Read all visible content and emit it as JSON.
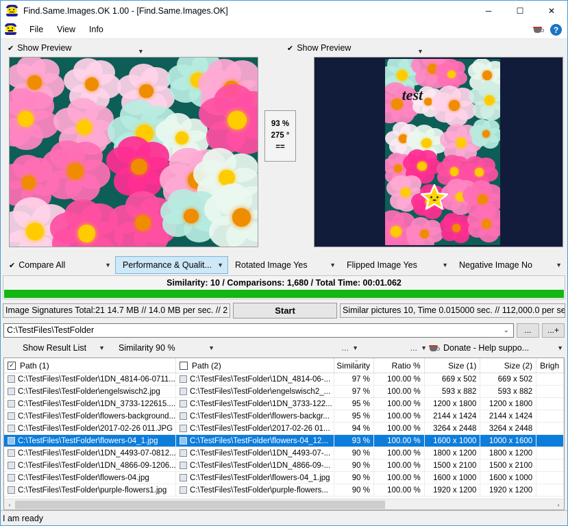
{
  "titlebar": {
    "title": "Find.Same.Images.OK 1.00 - [Find.Same.Images.OK]",
    "minimize": "─",
    "maximize": "☐",
    "close": "✕",
    "app_icon": "smiley-app-icon"
  },
  "menubar": {
    "items": [
      "File",
      "View",
      "Info"
    ],
    "right_icons": [
      "coffee-donate-icon",
      "help-question-icon"
    ],
    "help_glyph": "?"
  },
  "previews": {
    "left": {
      "label": "Show Preview",
      "check": "✔",
      "caret": "▼"
    },
    "right": {
      "label": "Show Preview",
      "check": "✔",
      "caret": "▼"
    },
    "center": {
      "percent": "93 %",
      "degrees": "275 °",
      "equals": "=="
    }
  },
  "options": [
    {
      "label": "Compare All",
      "check": "✔",
      "caret": "▼",
      "selected": false
    },
    {
      "label": "Performance & Qualit...",
      "check": "",
      "caret": "▼",
      "selected": true
    },
    {
      "label": "Rotated Image Yes",
      "check": "",
      "caret": "▼",
      "selected": false
    },
    {
      "label": "Flipped Image Yes",
      "check": "",
      "caret": "▼",
      "selected": false
    },
    {
      "label": "Negative Image No",
      "check": "",
      "caret": "▼",
      "selected": false
    }
  ],
  "status": {
    "similarity_line": "Similarity: 10 / Comparisons: 1,680 / Total Time: 00:01.062",
    "progress_percent": 100,
    "progress_color": "#13b713",
    "signatures": "Image Signatures Total:21  14.7 MB // 14.0 MB per sec. // 2",
    "start_button": "Start",
    "similar_pictures": "Similar pictures 10, Time 0.015000 sec. // 112,000.0 per se"
  },
  "path": {
    "value": "C:\\TestFiles\\TestFolder",
    "caret": "⌄",
    "browse": "...",
    "browse_add": "...+"
  },
  "filters": {
    "result_list": {
      "label": "Show Result List",
      "caret": "▼"
    },
    "similarity": {
      "label": "Similarity 90 %",
      "caret": "▼"
    },
    "extra1": {
      "label": "...",
      "caret": "▼"
    },
    "extra2": {
      "label": "...",
      "caret": "▼"
    },
    "donate": {
      "label": "Donate - Help suppo...",
      "caret": "▼",
      "icon": "coffee-donate-icon"
    }
  },
  "table": {
    "headers": {
      "path1": "Path (1)",
      "path2": "Path (2)",
      "similarity": "Similarity",
      "ratio": "Ratio %",
      "size1": "Size (1)",
      "size2": "Size (2)",
      "brightness": "Brigh"
    },
    "path1_checked": true,
    "path2_checked": false,
    "check_glyph": "✓",
    "sort_glyph": "⌄",
    "rows": [
      {
        "path1": "C:\\TestFiles\\TestFolder\\1DN_4814-06-0711...",
        "path2": "C:\\TestFiles\\TestFolder\\1DN_4814-06-...",
        "similarity": "97 %",
        "ratio": "100.00 %",
        "size1": "669 x 502",
        "size2": "669 x 502",
        "brightness": "",
        "selected": false
      },
      {
        "path1": "C:\\TestFiles\\TestFolder\\engelswisch2.jpg",
        "path2": "C:\\TestFiles\\TestFolder\\engelswisch2_...",
        "similarity": "97 %",
        "ratio": "100.00 %",
        "size1": "593 x 882",
        "size2": "593 x 882",
        "brightness": "",
        "selected": false
      },
      {
        "path1": "C:\\TestFiles\\TestFolder\\1DN_3733-122615....",
        "path2": "C:\\TestFiles\\TestFolder\\1DN_3733-122...",
        "similarity": "95 %",
        "ratio": "100.00 %",
        "size1": "1200 x 1800",
        "size2": "1200 x 1800",
        "brightness": "",
        "selected": false
      },
      {
        "path1": "C:\\TestFiles\\TestFolder\\flowers-background...",
        "path2": "C:\\TestFiles\\TestFolder\\flowers-backgr...",
        "similarity": "95 %",
        "ratio": "100.00 %",
        "size1": "2144 x 1424",
        "size2": "2144 x 1424",
        "brightness": "",
        "selected": false
      },
      {
        "path1": "C:\\TestFiles\\TestFolder\\2017-02-26 011.JPG",
        "path2": "C:\\TestFiles\\TestFolder\\2017-02-26 01...",
        "similarity": "94 %",
        "ratio": "100.00 %",
        "size1": "3264 x 2448",
        "size2": "3264 x 2448",
        "brightness": "",
        "selected": false
      },
      {
        "path1": "C:\\TestFiles\\TestFolder\\flowers-04_1.jpg",
        "path2": "C:\\TestFiles\\TestFolder\\flowers-04_12...",
        "similarity": "93 %",
        "ratio": "100.00 %",
        "size1": "1600 x 1000",
        "size2": "1000 x 1600",
        "brightness": "",
        "selected": true
      },
      {
        "path1": "C:\\TestFiles\\TestFolder\\1DN_4493-07-0812...",
        "path2": "C:\\TestFiles\\TestFolder\\1DN_4493-07-...",
        "similarity": "90 %",
        "ratio": "100.00 %",
        "size1": "1800 x 1200",
        "size2": "1800 x 1200",
        "brightness": "",
        "selected": false
      },
      {
        "path1": "C:\\TestFiles\\TestFolder\\1DN_4866-09-1206...",
        "path2": "C:\\TestFiles\\TestFolder\\1DN_4866-09-...",
        "similarity": "90 %",
        "ratio": "100.00 %",
        "size1": "1500 x 2100",
        "size2": "1500 x 2100",
        "brightness": "",
        "selected": false
      },
      {
        "path1": "C:\\TestFiles\\TestFolder\\flowers-04.jpg",
        "path2": "C:\\TestFiles\\TestFolder\\flowers-04_1.jpg",
        "similarity": "90 %",
        "ratio": "100.00 %",
        "size1": "1600 x 1000",
        "size2": "1600 x 1000",
        "brightness": "",
        "selected": false
      },
      {
        "path1": "C:\\TestFiles\\TestFolder\\purple-flowers1.jpg",
        "path2": "C:\\TestFiles\\TestFolder\\purple-flowers...",
        "similarity": "90 %",
        "ratio": "100.00 %",
        "size1": "1920 x 1200",
        "size2": "1920 x 1200",
        "brightness": "",
        "selected": false
      }
    ],
    "scroll_left": "‹",
    "scroll_right": "›"
  },
  "statusbar": {
    "text": "I am ready"
  },
  "colors": {
    "accent": "#0d7ddb",
    "progress": "#13b713",
    "selected_option": "#cde8f7",
    "preview_bg": "#111c3a",
    "window_border": "#4a9ad4"
  }
}
